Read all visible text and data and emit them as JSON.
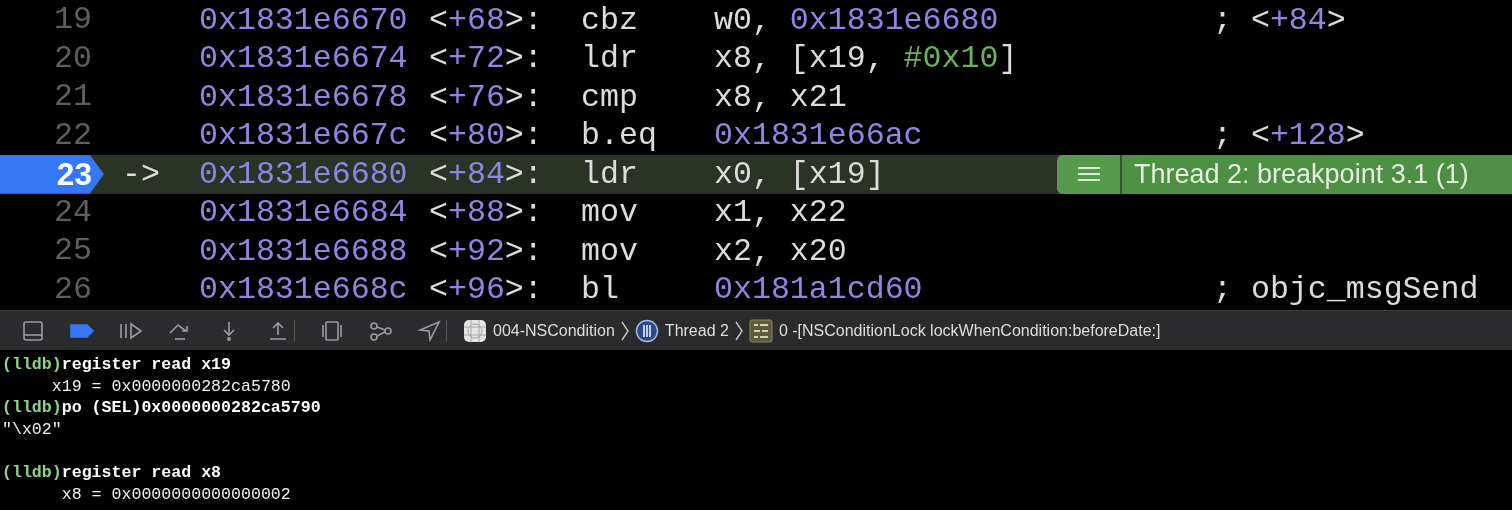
{
  "disassembly": {
    "rows": [
      {
        "number": "19",
        "current": false,
        "address": "0x1831e6670",
        "offset": [
          {
            "text": "<",
            "kind": "plain"
          },
          {
            "text": "+68",
            "kind": "number"
          },
          {
            "text": ">:",
            "kind": "plain"
          }
        ],
        "mnemonic": "cbz",
        "operands": [
          {
            "text": "w0, ",
            "kind": "plain"
          },
          {
            "text": "0x1831e6680",
            "kind": "number"
          }
        ],
        "comment": [
          {
            "text": "; <",
            "kind": "plain"
          },
          {
            "text": "+84",
            "kind": "number"
          },
          {
            "text": ">",
            "kind": "plain"
          }
        ]
      },
      {
        "number": "20",
        "current": false,
        "address": "0x1831e6674",
        "offset": [
          {
            "text": "<",
            "kind": "plain"
          },
          {
            "text": "+72",
            "kind": "number"
          },
          {
            "text": ">:",
            "kind": "plain"
          }
        ],
        "mnemonic": "ldr",
        "operands": [
          {
            "text": "x8, [x19, ",
            "kind": "plain"
          },
          {
            "text": "#0x10",
            "kind": "immediate"
          },
          {
            "text": "]",
            "kind": "plain"
          }
        ],
        "comment": []
      },
      {
        "number": "21",
        "current": false,
        "address": "0x1831e6678",
        "offset": [
          {
            "text": "<",
            "kind": "plain"
          },
          {
            "text": "+76",
            "kind": "number"
          },
          {
            "text": ">:",
            "kind": "plain"
          }
        ],
        "mnemonic": "cmp",
        "operands": [
          {
            "text": "x8, x21",
            "kind": "plain"
          }
        ],
        "comment": []
      },
      {
        "number": "22",
        "current": false,
        "address": "0x1831e667c",
        "offset": [
          {
            "text": "<",
            "kind": "plain"
          },
          {
            "text": "+80",
            "kind": "number"
          },
          {
            "text": ">:",
            "kind": "plain"
          }
        ],
        "mnemonic": "b.eq",
        "operands": [
          {
            "text": "0x1831e66ac",
            "kind": "number"
          }
        ],
        "comment": [
          {
            "text": "; <",
            "kind": "plain"
          },
          {
            "text": "+128",
            "kind": "number"
          },
          {
            "text": ">",
            "kind": "plain"
          }
        ]
      },
      {
        "number": "23",
        "current": true,
        "pointer": "->",
        "address": "0x1831e6680",
        "offset": [
          {
            "text": "<",
            "kind": "plain"
          },
          {
            "text": "+84",
            "kind": "number"
          },
          {
            "text": ">:",
            "kind": "plain"
          }
        ],
        "mnemonic": "ldr",
        "operands": [
          {
            "text": "x0, [x19]",
            "kind": "plain"
          }
        ],
        "comment": [],
        "annotation": "Thread 2: breakpoint 3.1 (1)"
      },
      {
        "number": "24",
        "current": false,
        "address": "0x1831e6684",
        "offset": [
          {
            "text": "<",
            "kind": "plain"
          },
          {
            "text": "+88",
            "kind": "number"
          },
          {
            "text": ">:",
            "kind": "plain"
          }
        ],
        "mnemonic": "mov",
        "operands": [
          {
            "text": "x1, x22",
            "kind": "plain"
          }
        ],
        "comment": []
      },
      {
        "number": "25",
        "current": false,
        "address": "0x1831e6688",
        "offset": [
          {
            "text": "<",
            "kind": "plain"
          },
          {
            "text": "+92",
            "kind": "number"
          },
          {
            "text": ">:",
            "kind": "plain"
          }
        ],
        "mnemonic": "mov",
        "operands": [
          {
            "text": "x2, x20",
            "kind": "plain"
          }
        ],
        "comment": []
      },
      {
        "number": "26",
        "current": false,
        "address": "0x1831e668c",
        "offset": [
          {
            "text": "<",
            "kind": "plain"
          },
          {
            "text": "+96",
            "kind": "number"
          },
          {
            "text": ">:",
            "kind": "plain"
          }
        ],
        "mnemonic": "bl",
        "operands": [
          {
            "text": "0x181a1cd60",
            "kind": "number"
          }
        ],
        "comment": [
          {
            "text": "; objc_msgSend",
            "kind": "plain"
          }
        ]
      }
    ]
  },
  "debug_bar": {
    "buttons": [
      {
        "kind": "hide-panel"
      },
      {
        "kind": "breakpoints",
        "on": true
      },
      {
        "kind": "continue"
      },
      {
        "kind": "step-over"
      },
      {
        "kind": "step-into"
      },
      {
        "kind": "step-out"
      },
      {
        "kind": "separator"
      },
      {
        "kind": "view-debugger"
      },
      {
        "kind": "memory-graph"
      },
      {
        "kind": "location"
      },
      {
        "kind": "separator"
      }
    ],
    "breadcrumbs": [
      {
        "kind": "app",
        "label": "004-NSCondition"
      },
      {
        "kind": "thread",
        "label": "Thread 2"
      },
      {
        "kind": "frame",
        "label": "0 -[NSConditionLock lockWhenCondition:beforeDate:]"
      }
    ]
  },
  "console": {
    "lines": [
      {
        "kind": "command",
        "prompt": "(lldb)",
        "text": "register read x19"
      },
      {
        "kind": "output",
        "text": "     x19 = 0x0000000282ca5780"
      },
      {
        "kind": "command",
        "prompt": "(lldb)",
        "text": "po (SEL)0x0000000282ca5790"
      },
      {
        "kind": "output",
        "text": "\"\\x02\""
      },
      {
        "kind": "blank"
      },
      {
        "kind": "command",
        "prompt": "(lldb)",
        "text": "register read x8"
      },
      {
        "kind": "output",
        "text": "      x8 = 0x0000000000000002"
      }
    ]
  }
}
